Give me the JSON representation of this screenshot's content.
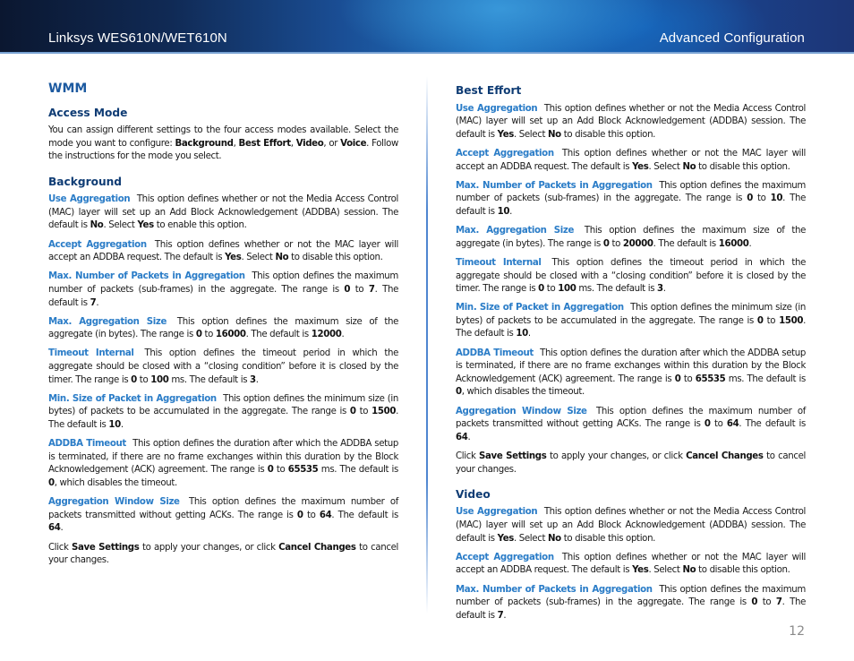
{
  "header": {
    "product": "Linksys WES610N/WET610N",
    "chapter": "Advanced Configuration"
  },
  "page_number": "12",
  "left_column": {
    "title": "WMM",
    "access_mode": {
      "heading": "Access Mode",
      "text_1": "You can assign different settings to the four access modes available. Select the mode you want to configure: ",
      "mode_1": "Background",
      "sep_1": ", ",
      "mode_2": "Best Effort",
      "sep_2": ", ",
      "mode_3": "Video",
      "sep_3": ", or ",
      "mode_4": "Voice",
      "text_2": ". Follow the instructions for the mode you select."
    },
    "background": {
      "heading": "Background",
      "use_aggregation": {
        "term": "Use Aggregation",
        "t1": " This option defines whether or not the Media Access Control (MAC) layer will set up an Add Block Acknowledgement (ADDBA) session. The default is ",
        "b1": "No",
        "t2": ". Select ",
        "b2": "Yes",
        "t3": " to enable this option."
      },
      "accept_aggregation": {
        "term": "Accept Aggregation",
        "t1": " This option defines whether or not the MAC layer will accept an ADDBA request. The default is ",
        "b1": "Yes",
        "t2": ". Select ",
        "b2": "No",
        "t3": " to disable this option."
      },
      "max_packets": {
        "term": "Max. Number of Packets in Aggregation",
        "t1": " This option defines the maximum number of packets (sub-frames) in the aggregate. The range is ",
        "b1": "0",
        "t2": " to ",
        "b2": "7",
        "t3": ". The default is ",
        "b3": "7",
        "t4": "."
      },
      "max_size": {
        "term": "Max. Aggregation Size",
        "t1": " This option defines the maximum size of the aggregate (in bytes). The range is ",
        "b1": "0",
        "t2": " to ",
        "b2": "16000",
        "t3": ". The default is ",
        "b3": "12000",
        "t4": "."
      },
      "timeout_internal": {
        "term": "Timeout Internal",
        "t1": " This option defines the timeout period in which the aggregate should be closed with a “closing condition” before it is closed by the timer. The range is ",
        "b1": "0",
        "t2": " to ",
        "b2": "100",
        "t3": " ms. The default is ",
        "b3": "3",
        "t4": "."
      },
      "min_size": {
        "term": "Min. Size of Packet in Aggregation",
        "t1": " This option defines the minimum size (in bytes) of packets to be accumulated in the aggregate. The range is ",
        "b1": "0",
        "t2": " to ",
        "b2": "1500",
        "t3": ". The default is ",
        "b3": "10",
        "t4": "."
      },
      "addba_timeout": {
        "term": "ADDBA Timeout",
        "t1": " This option defines the duration after which the ADDBA setup is terminated, if there are no frame exchanges within this duration by the Block Acknowledgement (ACK) agreement. The range is ",
        "b1": "0",
        "t2": " to ",
        "b2": "65535",
        "t3": " ms. The default is ",
        "b3": "0",
        "t4": ", which disables the timeout."
      },
      "window_size": {
        "term": "Aggregation Window Size",
        "t1": " This option defines the maximum number of packets transmitted without getting ACKs. The range is ",
        "b1": "0",
        "t2": " to ",
        "b2": "64",
        "t3": ". The default is ",
        "b3": "64",
        "t4": "."
      },
      "save_note": {
        "t1": "Click ",
        "b1": "Save Settings",
        "t2": " to apply your changes, or click ",
        "b2": "Cancel Changes",
        "t3": " to cancel your changes."
      }
    }
  },
  "right_column": {
    "best_effort": {
      "heading": "Best Effort",
      "use_aggregation": {
        "term": "Use Aggregation",
        "t1": " This option defines whether or not the Media Access Control (MAC) layer will set up an Add Block Acknowledgement (ADDBA) session. The default is ",
        "b1": "Yes",
        "t2": ". Select ",
        "b2": "No",
        "t3": " to disable this option."
      },
      "accept_aggregation": {
        "term": "Accept Aggregation",
        "t1": " This option defines whether or not the MAC layer will accept an ADDBA request. The default is ",
        "b1": "Yes",
        "t2": ". Select ",
        "b2": "No",
        "t3": " to disable this option."
      },
      "max_packets": {
        "term": "Max. Number of Packets in Aggregation",
        "t1": " This option defines the maximum number of packets (sub-frames) in the aggregate. The range is ",
        "b1": "0",
        "t2": " to ",
        "b2": "10",
        "t3": ". The default is ",
        "b3": "10",
        "t4": "."
      },
      "max_size": {
        "term": "Max. Aggregation Size",
        "t1": " This option defines the maximum size of the aggregate (in bytes). The range is ",
        "b1": "0",
        "t2": " to ",
        "b2": "20000",
        "t3": ". The default is ",
        "b3": "16000",
        "t4": "."
      },
      "timeout_internal": {
        "term": "Timeout Internal",
        "t1": " This option defines the timeout period in which the aggregate should be closed with a “closing condition” before it is closed by the timer. The range is ",
        "b1": "0",
        "t2": " to ",
        "b2": "100",
        "t3": " ms. The default is ",
        "b3": "3",
        "t4": "."
      },
      "min_size": {
        "term": "Min. Size of Packet in Aggregation",
        "t1": " This option defines the minimum size (in bytes) of packets to be accumulated in the aggregate. The range is ",
        "b1": "0",
        "t2": " to ",
        "b2": "1500",
        "t3": ". The default is ",
        "b3": "10",
        "t4": "."
      },
      "addba_timeout": {
        "term": "ADDBA Timeout",
        "t1": " This option defines the duration after which the ADDBA setup is terminated, if there are no frame exchanges within this duration by the Block Acknowledgement (ACK) agreement. The range is ",
        "b1": "0",
        "t2": " to ",
        "b2": "65535",
        "t3": " ms. The default is ",
        "b3": "0",
        "t4": ", which disables the timeout."
      },
      "window_size": {
        "term": "Aggregation Window Size",
        "t1": " This option defines the maximum number of packets transmitted without getting ACKs. The range is ",
        "b1": "0",
        "t2": " to ",
        "b2": "64",
        "t3": ". The default is ",
        "b3": "64",
        "t4": "."
      },
      "save_note": {
        "t1": "Click ",
        "b1": "Save Settings",
        "t2": " to apply your changes, or click ",
        "b2": "Cancel Changes",
        "t3": " to cancel your changes."
      }
    },
    "video": {
      "heading": "Video",
      "use_aggregation": {
        "term": "Use Aggregation",
        "t1": " This option defines whether or not the Media Access Control (MAC) layer will set up an Add Block Acknowledgement (ADDBA) session. The default is ",
        "b1": "Yes",
        "t2": ". Select ",
        "b2": "No",
        "t3": " to disable this option."
      },
      "accept_aggregation": {
        "term": "Accept Aggregation",
        "t1": " This option defines whether or not the MAC layer will accept an ADDBA request. The default is ",
        "b1": "Yes",
        "t2": ". Select ",
        "b2": "No",
        "t3": " to disable this option."
      },
      "max_packets": {
        "term": "Max. Number of Packets in Aggregation",
        "t1": " This option defines the maximum number of packets (sub-frames) in the aggregate. The range is ",
        "b1": "0",
        "t2": " to ",
        "b2": "7",
        "t3": ". The default is ",
        "b3": "7",
        "t4": "."
      }
    }
  },
  "colors": {
    "term_blue": "#2a7cc7",
    "heading_navy": "#0f3c74",
    "title_blue": "#1d5aa0",
    "page_number_gray": "#8a8a8a"
  }
}
